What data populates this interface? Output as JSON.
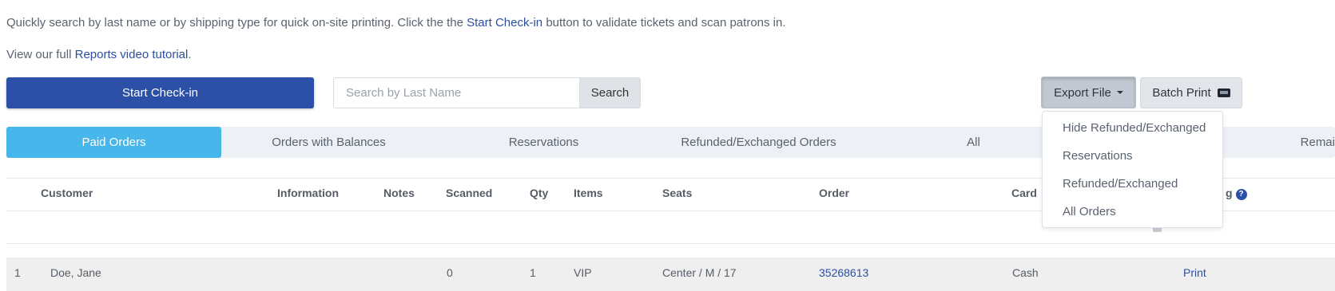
{
  "intro": {
    "line1_pre": "Quickly search by last name or by shipping type for quick on-site printing. Click the the ",
    "line1_link": "Start Check-in",
    "line1_post": " button to validate tickets and scan patrons in.",
    "line2_pre": "View our full ",
    "line2_link": "Reports video tutorial",
    "line2_post": "."
  },
  "toolbar": {
    "checkin_label": "Start Check-in",
    "search_placeholder": "Search by Last Name",
    "search_value": "",
    "search_button": "Search",
    "export_label": "Export File",
    "batch_print_label": "Batch Print"
  },
  "tabs": [
    {
      "label": "Paid Orders",
      "active": true
    },
    {
      "label": "Orders with Balances",
      "active": false
    },
    {
      "label": "Reservations",
      "active": false
    },
    {
      "label": "Refunded/Exchanged Orders",
      "active": false
    },
    {
      "label": "All",
      "active": false
    },
    {
      "label": "Remai",
      "active": false
    }
  ],
  "table": {
    "headers": [
      "Customer",
      "Information",
      "Notes",
      "Scanned",
      "Qty",
      "Items",
      "Seats",
      "Order",
      "Card",
      "g"
    ],
    "help_icon_text": "?",
    "rows": [
      {
        "num": "1",
        "customer": "Doe, Jane",
        "scanned": "0",
        "qty": "1",
        "items": "VIP",
        "seats": "Center / M / 17",
        "order": "35268613",
        "card": "Cash",
        "action": "Print"
      }
    ]
  },
  "export_menu": {
    "items": [
      "Hide Refunded/Exchanged",
      "Reservations",
      "Refunded/Exchanged",
      "All Orders"
    ]
  },
  "colors": {
    "primary": "#2c4fa8",
    "active_tab": "#47b6ea",
    "link": "#2b4ea3"
  }
}
